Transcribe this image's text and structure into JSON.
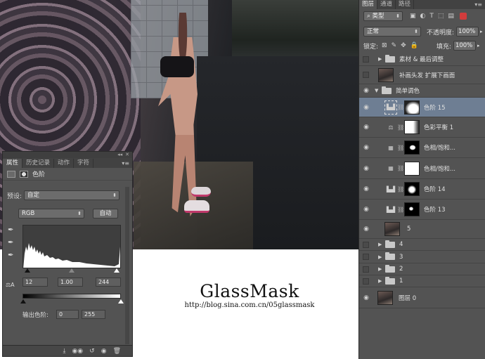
{
  "watermark": {
    "title": "GlassMask",
    "url": "http://blog.sina.com.cn/05glassmask"
  },
  "properties_panel": {
    "collapse": "◂◂",
    "close": "✕",
    "tabs": [
      "属性",
      "历史记录",
      "动作",
      "字符"
    ],
    "active_tab": 0,
    "menu": "▾≡",
    "adjustment_name": "色阶",
    "preset_label": "预设:",
    "preset_value": "自定",
    "channel_value": "RGB",
    "auto_button": "自动",
    "input_black": "12",
    "input_gamma": "1.00",
    "input_white": "244",
    "output_label": "输出色阶:",
    "output_black": "0",
    "output_white": "255",
    "scale_icon": "⚖A",
    "bottom_icons": [
      "⤓",
      "◉◉",
      "↺",
      "◉",
      "🗑"
    ]
  },
  "layers_panel": {
    "tabs": [
      "图层",
      "通道",
      "路径"
    ],
    "active_tab": 0,
    "menu": "▾≡",
    "filter_kind": "类型",
    "blend_mode": "正常",
    "opacity_label": "不透明度:",
    "opacity_value": "100%",
    "lock_label": "锁定:",
    "fill_label": "填充:",
    "fill_value": "100%",
    "filter_icons": [
      "▣",
      "◐",
      "T",
      "⬚",
      "▤"
    ],
    "lock_icons": [
      "⊠",
      "✎",
      "✥",
      "🔒"
    ],
    "layers": [
      {
        "name": "素材 & 最后调整",
        "type": "group",
        "visible": false,
        "expanded": false
      },
      {
        "name": "补画头发 扩展下画面",
        "type": "pixel",
        "visible": false
      },
      {
        "name": "简单调色",
        "type": "group",
        "visible": true,
        "expanded": true
      },
      {
        "name": "色阶 15",
        "type": "adjustment",
        "icon": "levels",
        "visible": true,
        "selected": true
      },
      {
        "name": "色彩平衡 1",
        "type": "adjustment",
        "icon": "balance",
        "visible": true
      },
      {
        "name": "色相/饱和...",
        "type": "adjustment",
        "icon": "hue",
        "visible": true
      },
      {
        "name": "色相/饱和...",
        "type": "adjustment",
        "icon": "hue",
        "visible": true
      },
      {
        "name": "色阶 14",
        "type": "adjustment",
        "icon": "levels",
        "visible": true
      },
      {
        "name": "色阶 13",
        "type": "adjustment",
        "icon": "levels",
        "visible": true
      },
      {
        "name": "5",
        "type": "pixel",
        "visible": true
      },
      {
        "name": "4",
        "type": "group",
        "visible": false,
        "expanded": false
      },
      {
        "name": "3",
        "type": "group",
        "visible": false,
        "expanded": false
      },
      {
        "name": "2",
        "type": "group",
        "visible": false,
        "expanded": false
      },
      {
        "name": "1",
        "type": "group",
        "visible": false,
        "expanded": false
      },
      {
        "name": "图层 0",
        "type": "pixel",
        "visible": true
      }
    ]
  }
}
